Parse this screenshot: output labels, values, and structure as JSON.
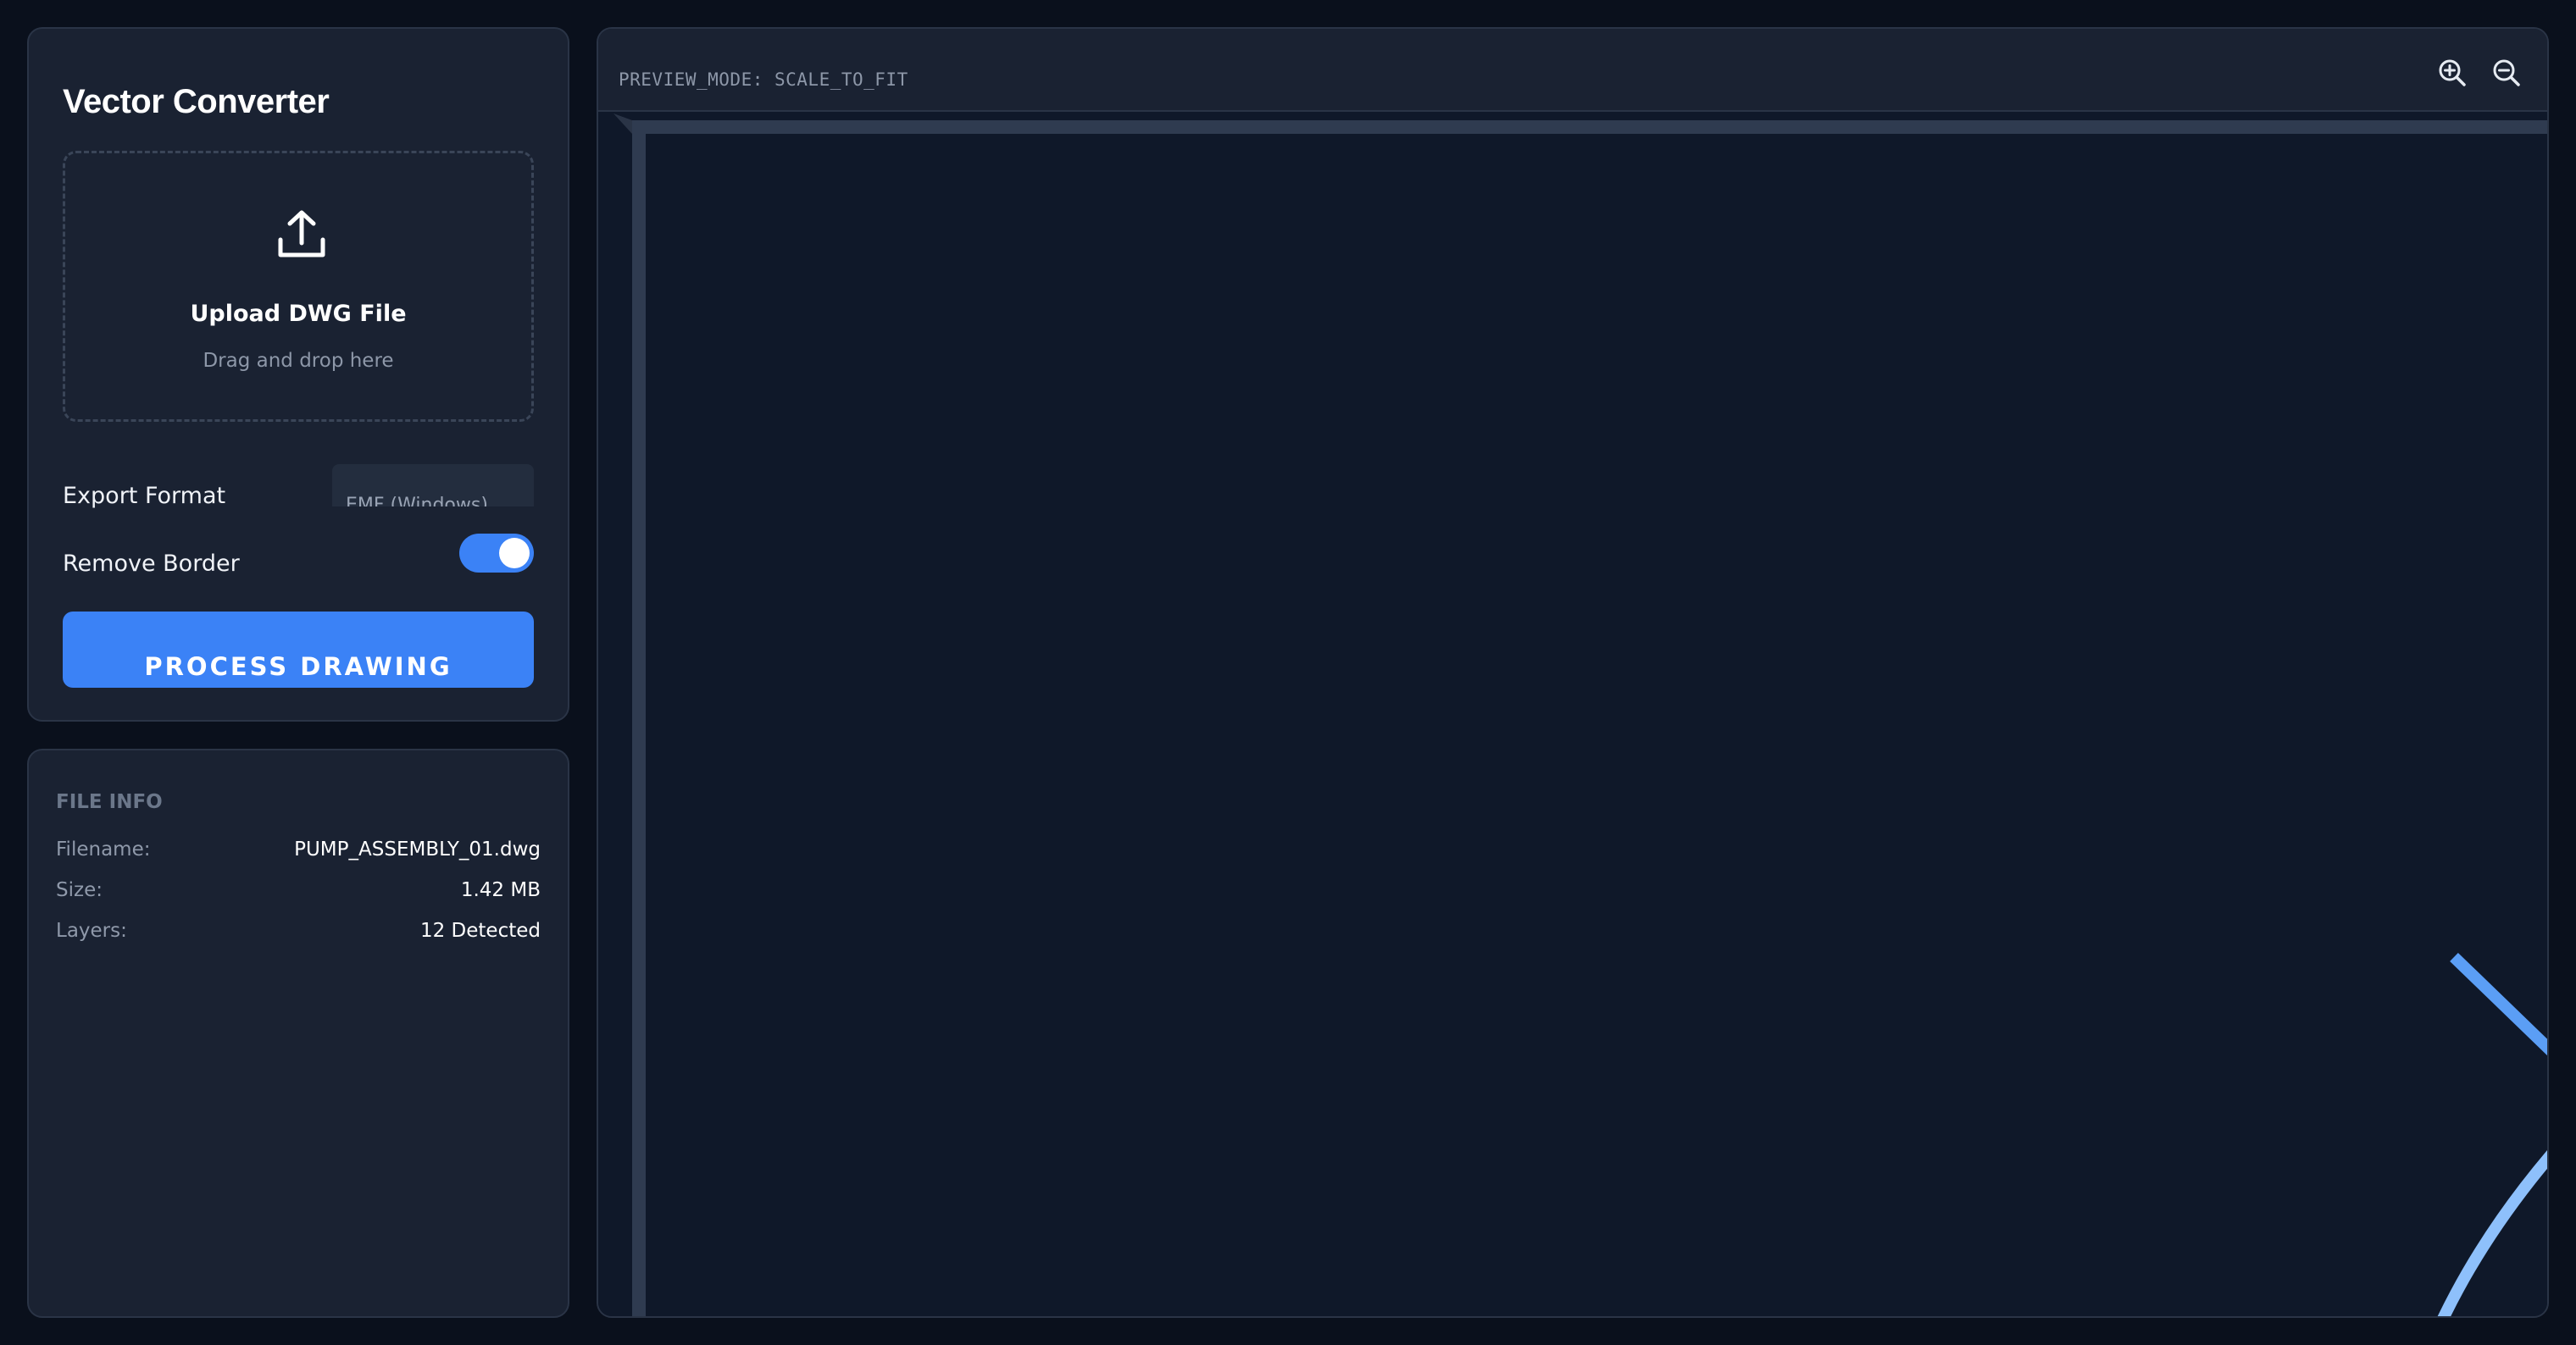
{
  "app": {
    "title": "Vector Converter"
  },
  "upload": {
    "title": "Upload DWG File",
    "subtitle": "Drag and drop here",
    "icon": "upload-icon"
  },
  "settings": {
    "export_label": "Export Format",
    "export_value": "EMF (Windows)",
    "remove_border_label": "Remove Border",
    "remove_border_on": true
  },
  "actions": {
    "process_label": "PROCESS DRAWING"
  },
  "file_info": {
    "heading": "FILE INFO",
    "rows": [
      {
        "key": "Filename:",
        "value": "PUMP_ASSEMBLY_01.dwg"
      },
      {
        "key": "Size:",
        "value": "1.42 MB"
      },
      {
        "key": "Layers:",
        "value": "12 Detected"
      }
    ]
  },
  "preview": {
    "mode_label": "PREVIEW_MODE: SCALE_TO_FIT",
    "zoom_in_icon": "zoom-in-icon",
    "zoom_out_icon": "zoom-out-icon"
  },
  "colors": {
    "accent": "#3b82f6",
    "drawing_line": "#5b9ef5",
    "drawing_arc": "#8ec0fb",
    "frame": "#2f3b50",
    "background": "#0a101c",
    "panel": "#1a2232"
  }
}
